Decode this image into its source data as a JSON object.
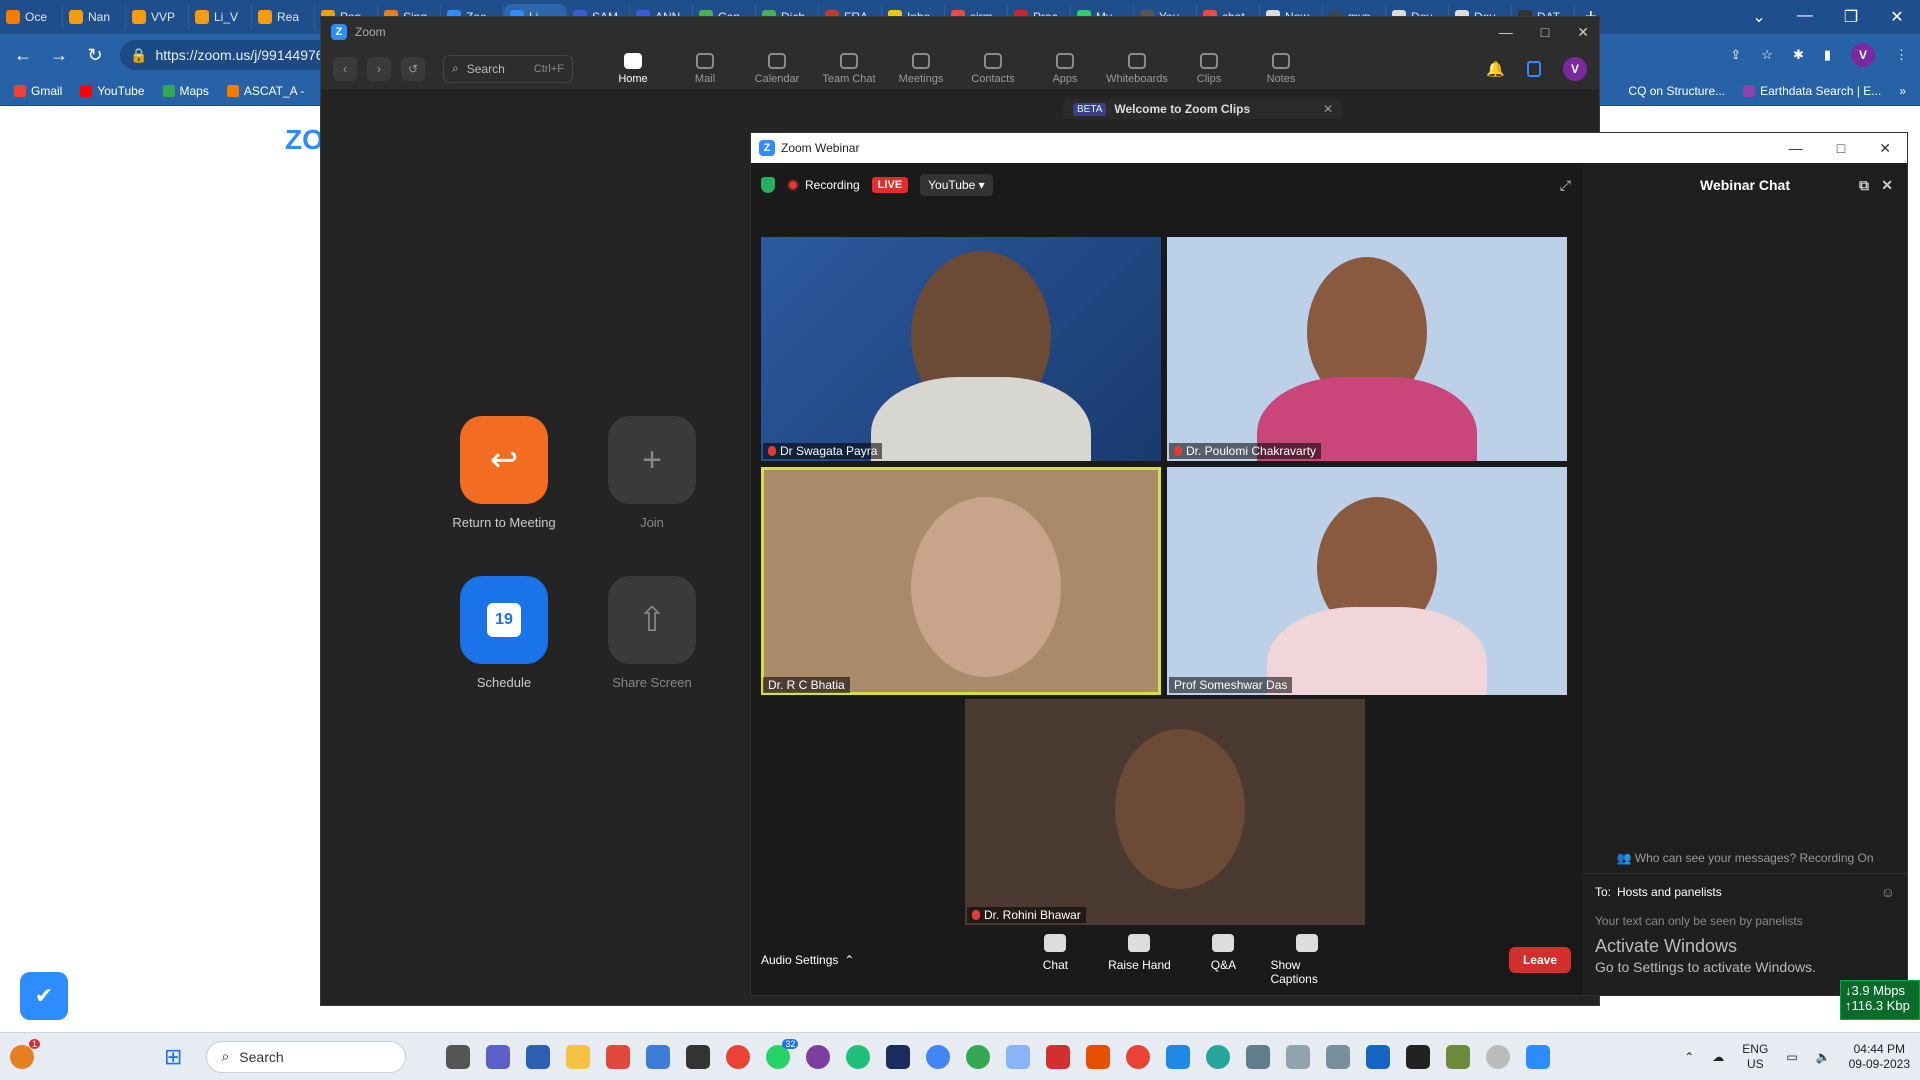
{
  "browser": {
    "tabs": [
      "Oce",
      "Nan",
      "VVP",
      "Li_V",
      "Rea",
      "Pap",
      "Sing",
      "Zoo",
      "Li",
      "SAM",
      "ANN",
      "Con",
      "Dich",
      "FRA",
      "Inbo",
      "sirm",
      "Prac",
      "My",
      "You",
      "chat",
      "New",
      "myp",
      "Dov",
      "Dov",
      "DAT"
    ],
    "url": "https://zoom.us/j/9914497669",
    "bookmarks": [
      "Gmail",
      "YouTube",
      "Maps",
      "ASCAT_A -",
      "CQ on Structure...",
      "Earthdata Search | E..."
    ],
    "profile": "V"
  },
  "zoom": {
    "title": "Zoom",
    "search_label": "Search",
    "search_shortcut": "Ctrl+F",
    "tabs": [
      "Home",
      "Mail",
      "Calendar",
      "Team Chat",
      "Meetings",
      "Contacts",
      "Apps",
      "Whiteboards",
      "Clips",
      "Notes"
    ],
    "avatar": "V",
    "home": {
      "return_label": "Return to Meeting",
      "join_label": "Join",
      "schedule_label": "Schedule",
      "schedule_day": "19",
      "share_label": "Share Screen"
    },
    "clips_banner_badge": "BETA",
    "clips_banner": "Welcome to Zoom Clips",
    "logo_partial": "ZO"
  },
  "webinar": {
    "title": "Zoom Webinar",
    "recording": "Recording",
    "live": "LIVE",
    "stream": "YouTube",
    "participants": [
      "Dr Swagata Payra",
      "Dr. Poulomi Chakravarty",
      "Dr. R C Bhatia",
      "Prof Someshwar Das",
      "Dr. Rohini Bhawar"
    ],
    "audio_settings": "Audio Settings",
    "toolbar": [
      "Chat",
      "Raise Hand",
      "Q&A",
      "Show Captions"
    ],
    "leave": "Leave",
    "chat": {
      "title": "Webinar Chat",
      "who": "Who can see your messages? Recording On",
      "to_label": "To:",
      "to_value": "Hosts and panelists",
      "placeholder": "Your text can only be seen by panelists"
    }
  },
  "windows_notice": {
    "title": "Activate Windows",
    "subtitle": "Go to Settings to activate Windows."
  },
  "network": {
    "down": "↓3.9 Mbps",
    "up": "↑116.3 Kbp"
  },
  "taskbar": {
    "search": "Search",
    "lang1": "ENG",
    "lang2": "US",
    "time": "04:44 PM",
    "date": "09-09-2023",
    "badge1": "1",
    "badge2": "32"
  }
}
